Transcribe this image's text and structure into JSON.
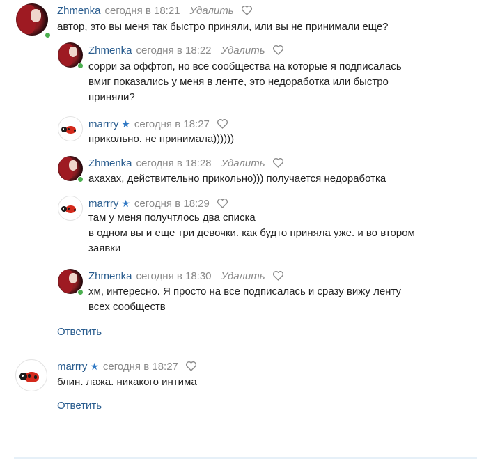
{
  "comments": [
    {
      "author": "Zhmenka",
      "time": "сегодня в 18:21",
      "delete_label": "Удалить",
      "lines": [
        "автор, это вы меня так быстро приняли, или вы не принимали еще?"
      ]
    },
    {
      "author": "Zhmenka",
      "time": "сегодня в 18:22",
      "delete_label": "Удалить",
      "lines": [
        "сорри за оффтоп, но все сообщества на которые я подписалась",
        "вмиг показались у меня в ленте, это недоработка или быстро",
        "приняли?"
      ]
    },
    {
      "author": "marrry",
      "time": "сегодня в 18:27",
      "lines": [
        "прикольно. не принимала))))))"
      ]
    },
    {
      "author": "Zhmenka",
      "time": "сегодня в 18:28",
      "delete_label": "Удалить",
      "lines": [
        "ахахах, действительно прикольно))) получается недоработка"
      ]
    },
    {
      "author": "marrry",
      "time": "сегодня в 18:29",
      "lines": [
        "там у меня получтлось два списка",
        "в одном вы и еще три девочки. как будто приняла уже. и во втором",
        "заявки"
      ]
    },
    {
      "author": "Zhmenka",
      "time": "сегодня в 18:30",
      "delete_label": "Удалить",
      "lines": [
        "хм, интересно. Я просто на все подписалась и сразу вижу ленту",
        "всех сообществ"
      ]
    },
    {
      "author": "marrry",
      "time": "сегодня в 18:27",
      "lines": [
        "блин. лажа. никакого интима"
      ]
    }
  ],
  "reply_label": "Ответить",
  "icons": {
    "verified": "star-icon",
    "like": "heart-icon",
    "online": "online-dot"
  },
  "colors": {
    "author": "#2a5d8f",
    "muted": "#8a8a8a",
    "verified_star": "#2f78c4",
    "online": "#4caf50"
  }
}
